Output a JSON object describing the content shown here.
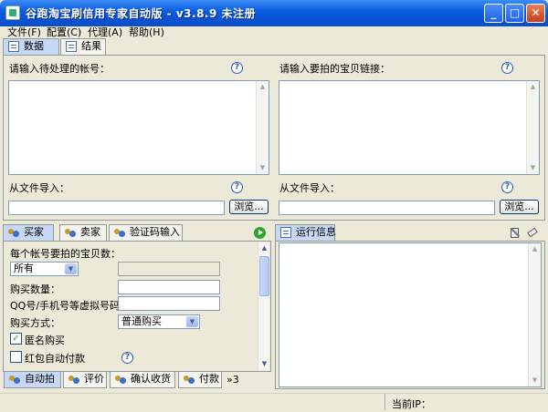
{
  "window": {
    "title": "谷跑淘宝刷信用专家自动版 - v3.8.9 未注册"
  },
  "menu": [
    {
      "label": "文件(F)"
    },
    {
      "label": "配置(C)"
    },
    {
      "label": "代理(A)"
    },
    {
      "label": "帮助(H)"
    }
  ],
  "main_tabs": [
    {
      "label": "数据"
    },
    {
      "label": "结果"
    }
  ],
  "data_panel": {
    "accounts_label": "请输入待处理的帐号：",
    "links_label": "请输入要拍的宝贝链接：",
    "import_label_left": "从文件导入：",
    "import_label_right": "从文件导入：",
    "browse_left": "浏览...",
    "browse_right": "浏览...",
    "help": "?"
  },
  "lower_tabs": [
    {
      "label": "买家"
    },
    {
      "label": "卖家"
    },
    {
      "label": "验证码输入"
    }
  ],
  "buyer_form": {
    "items_per_account_label": "每个帐号要拍的宝贝数：",
    "items_per_account_value": "所有",
    "quantity_label": "购买数量：",
    "qq_label": "QQ号/手机号等虚拟号码：",
    "purchase_method_label": "购买方式：",
    "purchase_method_value": "普通购买",
    "anonymous_label": "匿名购买",
    "anonymous_checked": "✓",
    "red_packet_label": "红包自动付款",
    "help": "?"
  },
  "bottom_tabs": [
    {
      "label": "自动拍"
    },
    {
      "label": "评价"
    },
    {
      "label": "确认收货"
    },
    {
      "label": "付款"
    },
    {
      "label": "»3"
    }
  ],
  "run_info": {
    "title": "运行信息"
  },
  "status": {
    "current_ip_label": "当前IP："
  }
}
